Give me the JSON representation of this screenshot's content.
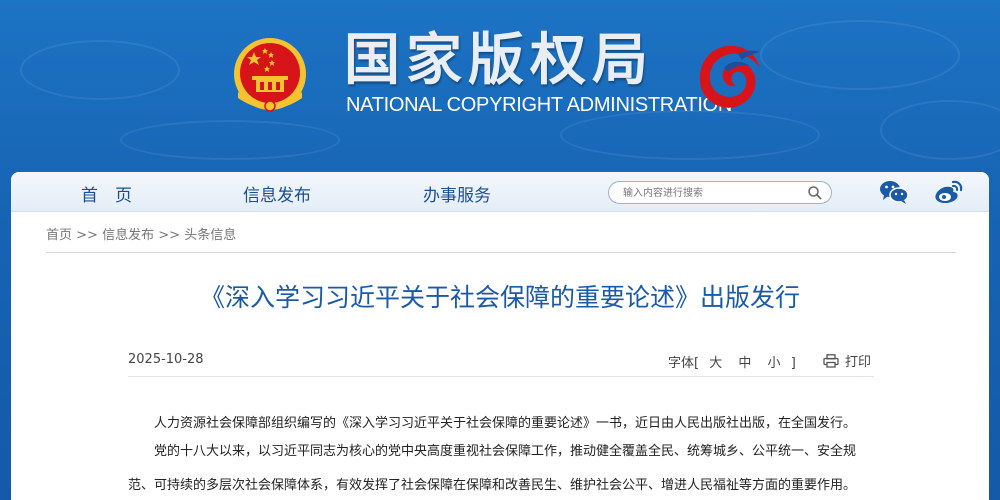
{
  "header": {
    "title": "国家版权局",
    "subtitle": "NATIONAL COPYRIGHT ADMINISTRATION",
    "emblem_icon": "national-emblem-icon",
    "logo_icon": "copyright-swirl-logo-icon",
    "colors": {
      "banner": "#1763b3",
      "emblem_red": "#d7141a",
      "emblem_gold": "#f4c430"
    }
  },
  "nav": {
    "items": [
      {
        "label": "首　页"
      },
      {
        "label": "信息发布"
      },
      {
        "label": "办事服务"
      }
    ],
    "search": {
      "placeholder": "输入内容进行搜索",
      "icon": "search-icon"
    },
    "social": [
      {
        "icon": "wechat-icon"
      },
      {
        "icon": "weibo-icon"
      }
    ],
    "colors": {
      "text": "#1a4f96"
    }
  },
  "breadcrumb": {
    "items": [
      "首页",
      "信息发布",
      "头条信息"
    ],
    "separator": ">>"
  },
  "article": {
    "title": "《深入学习习近平关于社会保障的重要论述》出版发行",
    "date": "2025-10-28",
    "font_size": {
      "label": "字体",
      "open_bracket": "[",
      "close_bracket": "]",
      "options": [
        "大",
        "中",
        "小"
      ]
    },
    "print_label": "打印",
    "print_icon": "printer-icon",
    "paragraphs": [
      "人力资源社会保障部组织编写的《深入学习习近平关于社会保障的重要论述》一书，近日由人民出版社出版，在全国发行。",
      "党的十八大以来，以习近平同志为核心的党中央高度重视社会保障工作，推动健全覆盖全民、统筹城乡、公平统一、安全规",
      "范、可持续的多层次社会保障体系，有效发挥了社会保障在保障和改善民生、维护社会公平、增进人民福祉等方面的重要作用。"
    ],
    "colors": {
      "title": "#1b5aa6"
    }
  }
}
